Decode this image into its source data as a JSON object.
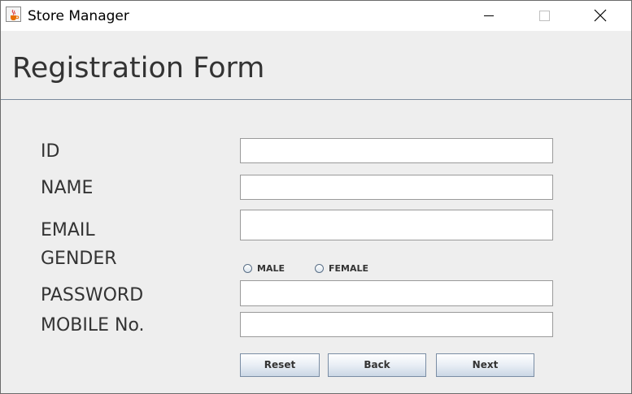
{
  "window": {
    "title": "Store Manager",
    "icon": "java-cup-icon",
    "controls": [
      "minimize-icon",
      "maximize-icon",
      "close-icon"
    ]
  },
  "form": {
    "title": "Registration Form",
    "labels": {
      "id": "ID",
      "name": "NAME",
      "email": "EMAIL",
      "gender": "GENDER",
      "password": "PASSWORD",
      "mobile": "MOBILE No."
    },
    "values": {
      "id": "",
      "name": "",
      "email": "",
      "password": "",
      "mobile": ""
    },
    "gender_options": {
      "male": "MALE",
      "female": "FEMALE"
    },
    "buttons": {
      "reset": "Reset",
      "back": "Back",
      "next": "Next"
    }
  },
  "colors": {
    "window_bg": "#eeeeee",
    "titlebar_bg": "#ffffff",
    "separator": "#7a8a9c",
    "button_border": "#7a8da4"
  }
}
